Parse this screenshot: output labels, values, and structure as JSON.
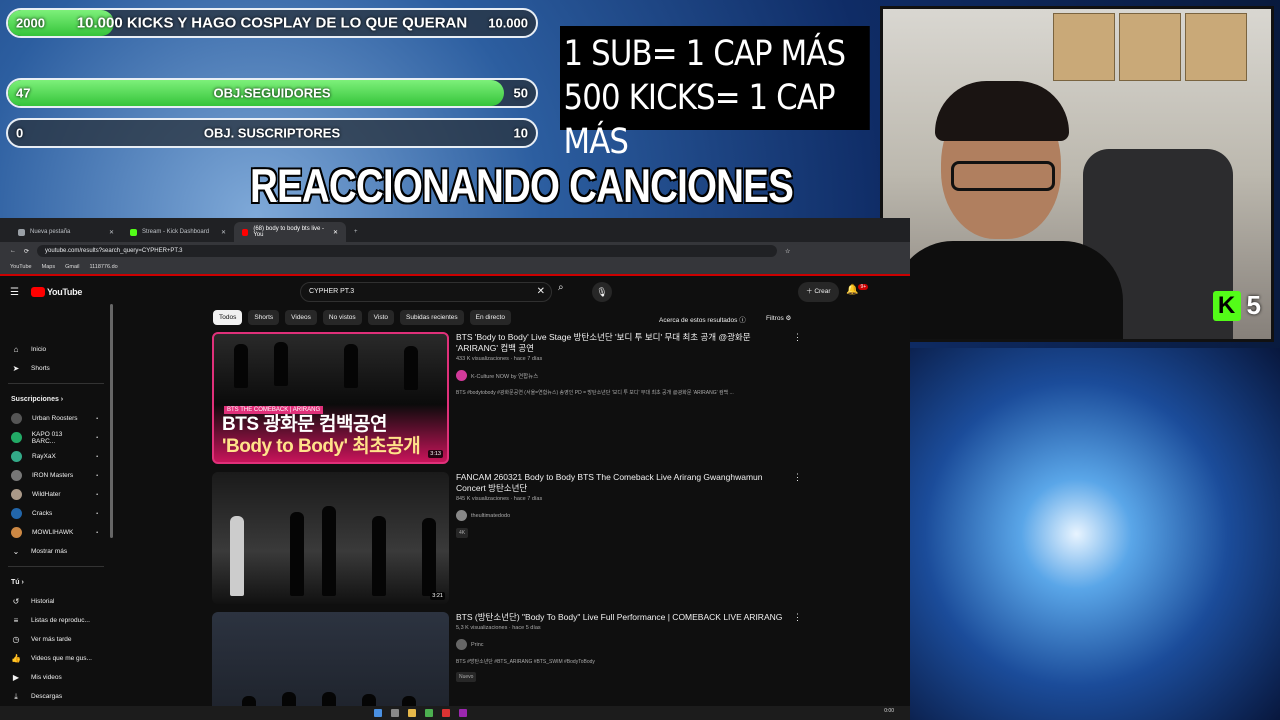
{
  "overlay": {
    "bar1": {
      "left": "2000",
      "center": "10.000 KICKS Y HAGO COSPLAY DE LO QUE QUERAN",
      "right": "10.000",
      "progress": 0.2
    },
    "bar2": {
      "left": "47",
      "center": "OBJ.SEGUIDORES",
      "right": "50",
      "progress": 0.94
    },
    "bar3": {
      "left": "0",
      "center": "OBJ. SUSCRIPTORES",
      "right": "10",
      "progress": 0
    },
    "goal_line1": "1 SUB= 1 CAP MÁS",
    "goal_line2": "500 KICKS= 1 CAP MÁS",
    "headline": "REACCIONANDO CANCIONES",
    "kick_letter": "K",
    "kick_count": "5",
    "accent": "#53fc18"
  },
  "browser": {
    "tabs": [
      {
        "label": "Nueva pestaña"
      },
      {
        "label": "Stream - Kick Dashboard"
      },
      {
        "label": "(68) body to body bts live - You"
      }
    ],
    "url": "youtube.com/results?search_query=CYPHER+PT.3",
    "bookmarks": [
      "YouTube",
      "Maps",
      "Gmail",
      "1118776.do"
    ]
  },
  "youtube": {
    "logo": "YouTube",
    "search_value": "CYPHER PT.3",
    "create_label": "Crear",
    "notif_badge": "9+",
    "chips": [
      "Todos",
      "Shorts",
      "Videos",
      "No vistos",
      "Visto",
      "Subidas recientes",
      "En directo"
    ],
    "about": "Acerca de estos resultados",
    "filters": "Filtros",
    "sidebar": {
      "top": [
        "Inicio",
        "Shorts"
      ],
      "subs_header": "Suscripciones",
      "subs": [
        "Urban Roosters",
        "KAPO 013 BARC...",
        "RayXaX",
        "IRON Masters",
        "WildHater",
        "Cracks",
        "MOWLIHAWK"
      ],
      "show_more": "Mostrar más",
      "you_header": "Tú",
      "you": [
        "Historial",
        "Listas de reproduc...",
        "Ver más tarde",
        "Videos que me gus...",
        "Mis videos",
        "Descargas"
      ]
    },
    "results": [
      {
        "title": "BTS 'Body to Body' Live Stage 방탄소년단 '보디 투 보디' 무대 최초 공개 @광화문 'ARIRANG' 컴백 공연",
        "meta": "433 K visualizaciones · hace 7 días",
        "channel": "K-Culture NOW by 연합뉴스",
        "desc": "BTS #bodytobody #광화문공연 (서울=연합뉴스) 송영인 PD = 방탄소년단 '보디 투 보디' 무대 최초 공개 @광화문 'ARIRANG' 컴백 ...",
        "duration": "3:13",
        "thumb_tag": "BTS THE COMEBACK | ARIRANG",
        "thumb_line1": "BTS 광화문 컴백공연",
        "thumb_line2": "'Body to Body' 최초공개"
      },
      {
        "title": "FANCAM 260321 Body to Body BTS The Comeback Live Arirang Gwanghwamun Concert 방탄소년단",
        "meta": "845 K visualizaciones · hace 7 días",
        "channel": "theultimatedodo",
        "badge": "4K",
        "duration": "3:21"
      },
      {
        "title": "BTS (방탄소년단) \"Body To Body\" Live Full Performance | COMEBACK LIVE ARIRANG",
        "meta": "5,3 K visualizaciones · hace 5 días",
        "channel": "Princ",
        "desc": "BTS #방탄소년단 #BTS_ARIRANG #BTS_SWIM #BodyToBody",
        "badge": "Nuevo"
      }
    ]
  },
  "taskbar": {
    "clock": "0:00"
  }
}
